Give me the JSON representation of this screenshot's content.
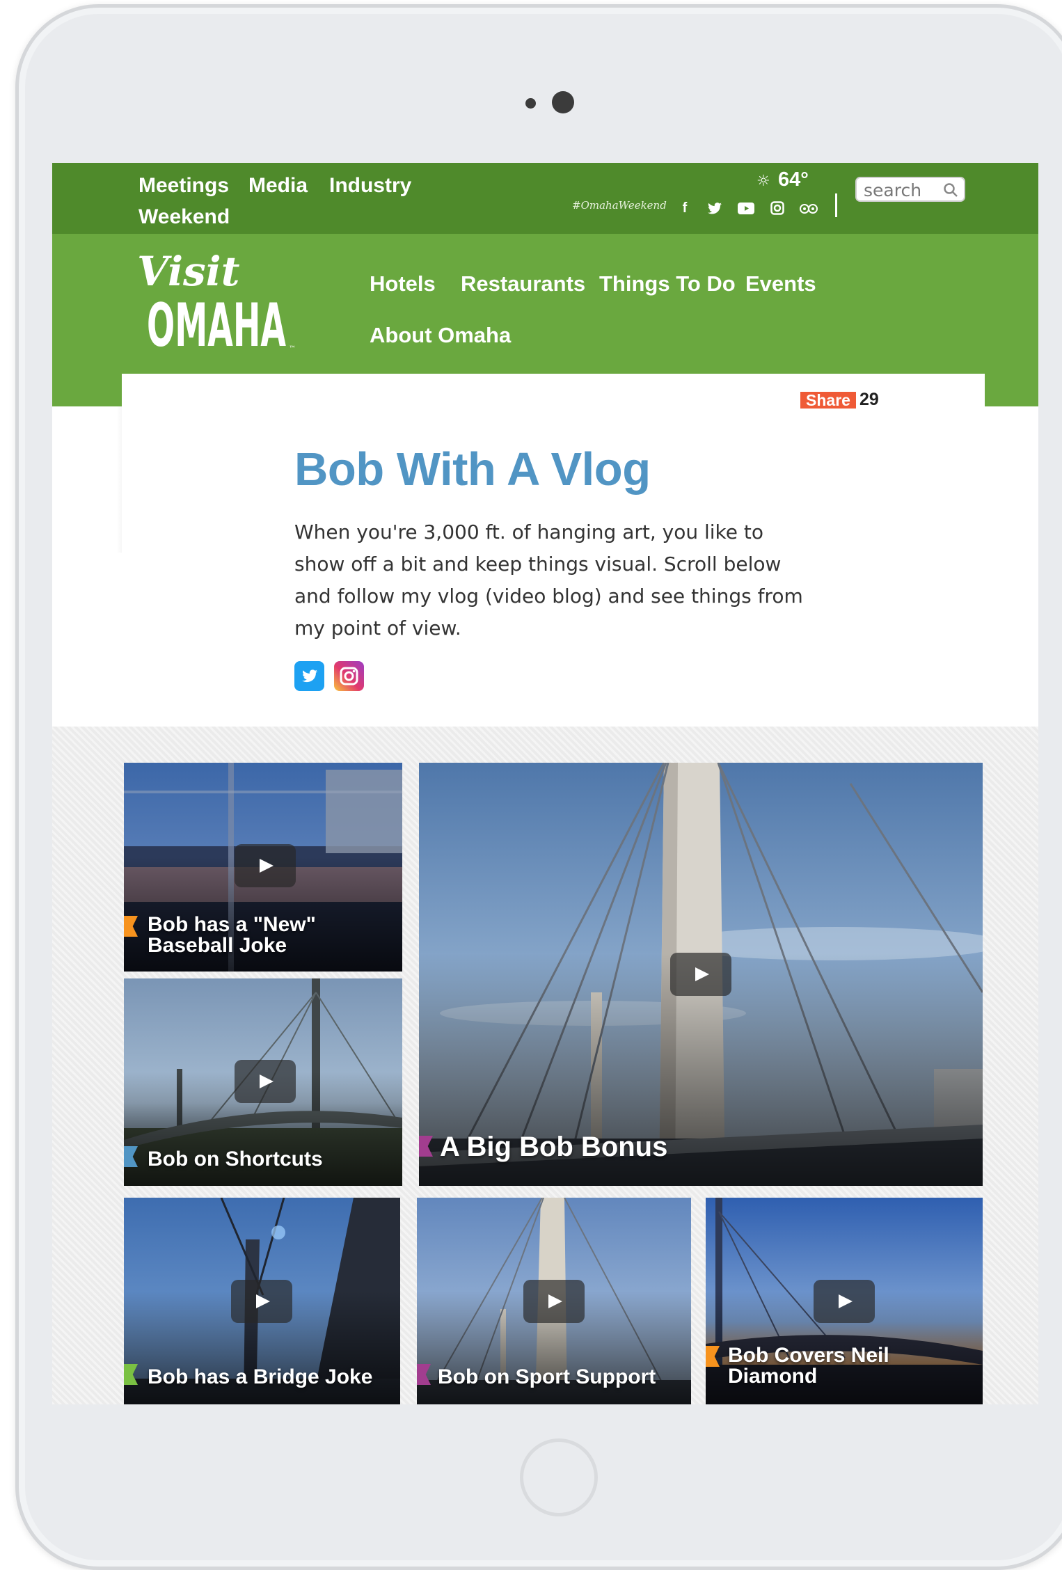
{
  "utility_nav": {
    "links": [
      "Meetings",
      "Media",
      "Industry",
      "Weekend"
    ]
  },
  "hashtag": "#OmahaWeekend",
  "social_bar": {
    "icons": [
      "facebook-icon",
      "twitter-icon",
      "youtube-icon",
      "instagram-icon",
      "tripadvisor-icon"
    ]
  },
  "weather": {
    "temp": "64°",
    "icon": "sun-icon"
  },
  "search": {
    "placeholder": "search"
  },
  "logo": {
    "line1": "Visit",
    "line2": "OMAHA",
    "tm": "™"
  },
  "main_nav": {
    "items": [
      "Hotels",
      "Restaurants",
      "Things To Do",
      "Events",
      "About Omaha"
    ]
  },
  "share": {
    "label": "Share",
    "count": "29"
  },
  "page": {
    "title": "Bob With A Vlog",
    "intro": "When you're 3,000 ft. of hanging art, you like to show off a bit and keep things visual. Scroll below and follow my vlog (video blog) and see things from my point of view."
  },
  "page_social": [
    "twitter-icon",
    "instagram-icon"
  ],
  "videos": [
    {
      "title": "Bob has a \"New\" Baseball Joke",
      "flag_color": "#f7931e"
    },
    {
      "title": "Bob on Shortcuts",
      "flag_color": "#5195c4"
    },
    {
      "title": "A Big Bob Bonus",
      "flag_color": "#a23d8f"
    },
    {
      "title": "Bob has a Bridge Joke",
      "flag_color": "#7ac143"
    },
    {
      "title": "Bob on Sport Support",
      "flag_color": "#a23d8f"
    },
    {
      "title": "Bob Covers Neil Diamond",
      "flag_color": "#f7931e"
    }
  ],
  "colors": {
    "topbar": "#4f8a2b",
    "navbar": "#6aa83f",
    "title_blue": "#5195c4",
    "share_orange": "#ef5a36"
  }
}
